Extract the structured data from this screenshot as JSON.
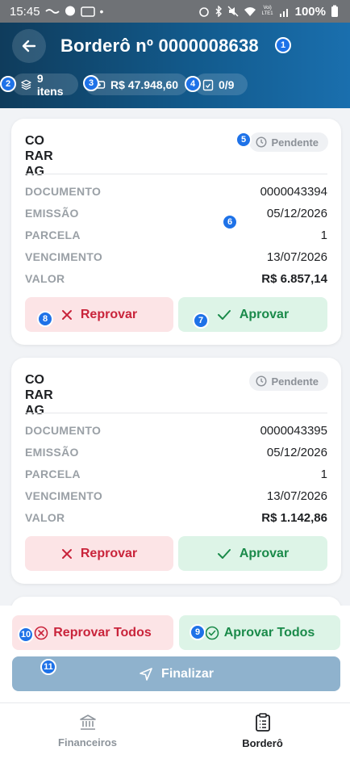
{
  "status_bar": {
    "time": "15:45",
    "battery": "100%",
    "network": "Voi) LTE1"
  },
  "header": {
    "title": "Borderô nº 0000008638",
    "chips": {
      "items": "9 itens",
      "total": "R$ 47.948,60",
      "progress": "0/9"
    }
  },
  "cards": [
    {
      "name_line1": "CO",
      "name_line1_tail": "RARIA",
      "name_line2": "AG",
      "status": "Pendente",
      "fields": [
        {
          "label": "DOCUMENTO",
          "value": "0000043394"
        },
        {
          "label": "EMISSÃO",
          "value": "05/12/2026"
        },
        {
          "label": "PARCELA",
          "value": "1"
        },
        {
          "label": "VENCIMENTO",
          "value": "13/07/2026"
        },
        {
          "label": "VALOR",
          "value": "R$ 6.857,14"
        }
      ],
      "reject_label": "Reprovar",
      "approve_label": "Aprovar"
    },
    {
      "name_line1": "CO",
      "name_line1_tail": "RARIA",
      "name_line2": "AG",
      "status": "Pendente",
      "fields": [
        {
          "label": "DOCUMENTO",
          "value": "0000043395"
        },
        {
          "label": "EMISSÃO",
          "value": "05/12/2026"
        },
        {
          "label": "PARCELA",
          "value": "1"
        },
        {
          "label": "VENCIMENTO",
          "value": "13/07/2026"
        },
        {
          "label": "VALOR",
          "value": "R$ 1.142,86"
        }
      ],
      "reject_label": "Reprovar",
      "approve_label": "Aprovar"
    }
  ],
  "actions": {
    "reject_all": "Reprovar Todos",
    "approve_all": "Aprovar Todos",
    "finalize": "Finalizar"
  },
  "nav": {
    "financeiros": "Financeiros",
    "bordero": "Borderô"
  },
  "annotations": [
    "1",
    "2",
    "3",
    "4",
    "5",
    "6",
    "7",
    "8",
    "9",
    "10",
    "11"
  ],
  "colors": {
    "header_start": "#0f3c5c",
    "header_end": "#1a6fae",
    "reject": "#c9243b",
    "approve": "#1a8a4a",
    "finalize": "#8fb2cd",
    "badge": "#1e72e8"
  },
  "icons": [
    "back-arrow-icon",
    "layers-icon",
    "money-icon",
    "clipboard-check-icon",
    "clock-icon",
    "x-icon",
    "check-icon",
    "x-circle-icon",
    "check-circle-icon",
    "send-icon",
    "bank-icon",
    "list-icon"
  ]
}
